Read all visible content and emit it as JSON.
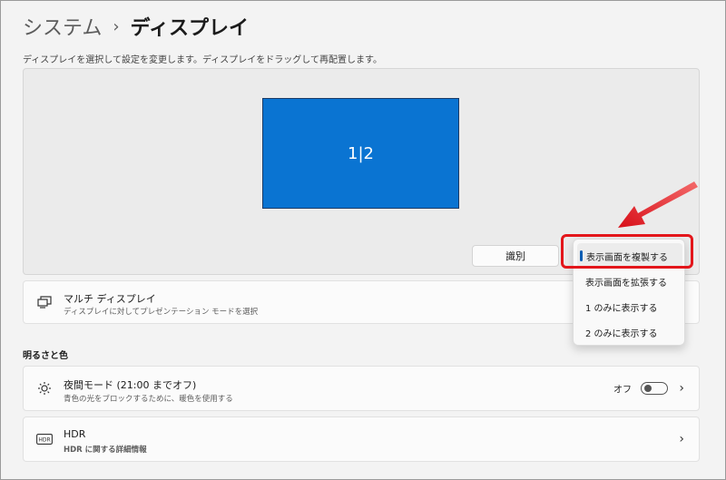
{
  "breadcrumb": {
    "parent": "システム",
    "separator": "›",
    "current": "ディスプレイ"
  },
  "hint": "ディスプレイを選択して設定を変更します。ディスプレイをドラッグして再配置します。",
  "display_area": {
    "monitor_label": "1|2",
    "identify_label": "識別"
  },
  "dropdown": {
    "items": [
      "表示画面を複製する",
      "表示画面を拡張する",
      "1 のみに表示する",
      "2 のみに表示する"
    ],
    "selected_index": 0
  },
  "multi_display": {
    "title": "マルチ ディスプレイ",
    "subtitle": "ディスプレイに対してプレゼンテーション モードを選択"
  },
  "section_brightness": "明るさと色",
  "night_mode": {
    "title": "夜間モード (21:00 までオフ)",
    "subtitle": "青色の光をブロックするために、暖色を使用する",
    "toggle_label": "オフ",
    "toggle_on": false
  },
  "hdr": {
    "title": "HDR",
    "link": "HDR に関する詳細情報",
    "icon_text": "HDR"
  },
  "colors": {
    "accent": "#0a74d2",
    "link": "#0a5db3",
    "highlight": "#e3161b"
  }
}
